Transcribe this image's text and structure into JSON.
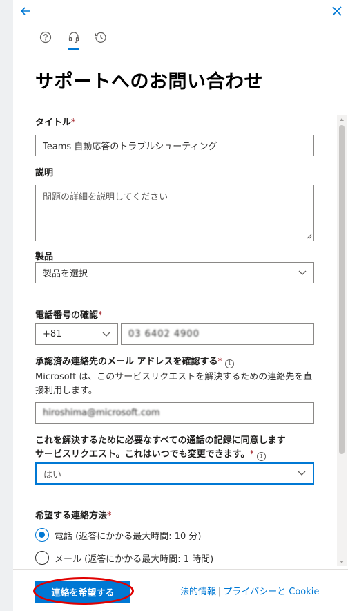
{
  "nav": {
    "back_icon": "arrow-left-icon",
    "close_icon": "close-icon",
    "tabs": [
      {
        "icon": "help-icon",
        "active": false
      },
      {
        "icon": "headset-icon",
        "active": true
      },
      {
        "icon": "history-icon",
        "active": false
      }
    ]
  },
  "page_title": "サポートへのお問い合わせ",
  "form": {
    "title": {
      "label": "タイトル",
      "required": "*",
      "value": "Teams 自動応答のトラブルシューティング"
    },
    "description": {
      "label": "説明",
      "placeholder": "問題の詳細を説明してください"
    },
    "product": {
      "label": "製品",
      "value": "製品を選択"
    },
    "phone": {
      "label": "電話番号の確認",
      "required": "*",
      "country_code": "+81",
      "number": "03 6402 4900"
    },
    "email": {
      "label": "承認済み連絡先のメール アドレスを確認する",
      "required": "*",
      "description": "Microsoft は、このサービスリクエストを解決するための連絡先を直接利用します。",
      "value": "hiroshima@microsoft.com"
    },
    "consent": {
      "label_line1": "これを解決するために必要なすべての通話の記録に同意します",
      "label_line2": "サービスリクエスト。これはいつでも変更できます。",
      "required": "*",
      "value": "はい"
    },
    "contact_method": {
      "label": "希望する連絡方法",
      "required": "*",
      "options": [
        {
          "label": "電話 (返答にかかる最大時間: 10 分)",
          "selected": true
        },
        {
          "label": "メール (返答にかかる最大時間: 1 時間)",
          "selected": false
        }
      ]
    }
  },
  "footer": {
    "submit_label": "連絡を希望する",
    "legal_link": "法的情報",
    "separator": "|",
    "privacy_link": "プライバシーと Cookie"
  },
  "colors": {
    "accent": "#0078d4",
    "required": "#a4262c",
    "highlight": "#e00000"
  }
}
